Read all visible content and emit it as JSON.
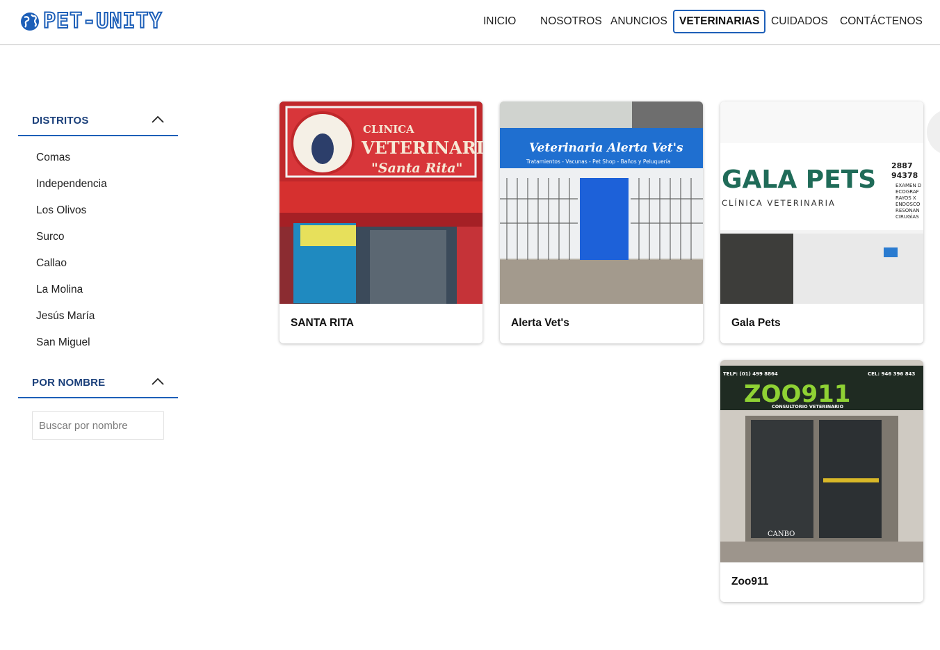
{
  "brand": {
    "name": "PET-UNITY",
    "color": "#1d5fb8"
  },
  "nav": {
    "items": [
      {
        "label": "INICIO"
      },
      {
        "label": "NOSOTROS"
      },
      {
        "label": "ANUNCIOS"
      },
      {
        "label": "VETERINARIAS",
        "active": true
      },
      {
        "label": "CUIDADOS"
      },
      {
        "label": "CONTÁCTENOS"
      }
    ]
  },
  "sidebar": {
    "districts_title": "DISTRITOS",
    "districts": [
      "Comas",
      "Independencia",
      "Los Olivos",
      "Surco",
      "Callao",
      "La Molina",
      "Jesús María",
      "San Miguel"
    ],
    "name_title": "POR NOMBRE",
    "search": {
      "placeholder": "Buscar por nombre",
      "value": ""
    }
  },
  "cards": [
    {
      "name": "SANTA RITA",
      "sign_lines": [
        "CLINICA",
        "VETERINARIA",
        "\"Santa Rita\""
      ]
    },
    {
      "name": "Alerta Vet's",
      "sign_lines": [
        "Veterinaria Alerta Vet's",
        "Tratamientos - Vacunas - Pet Shop - Baños y Peluquería"
      ]
    },
    {
      "name": "Gala Pets",
      "sign_lines": [
        "GALA PETS",
        "CLÍNICA VETERINARIA",
        "2887",
        "94378",
        "EXAMEN D",
        "ECOGRAF",
        "RAYOS X",
        "ENDOSCO",
        "RESONAN",
        "CIRUGÍAS"
      ]
    },
    {
      "name": "Zoo911",
      "sign_lines": [
        "TELF: (01) 499 8864",
        "CEL: 946 396 843",
        "ZOO911",
        "CONSULTORIO VETERINARIO",
        "CANBO"
      ]
    }
  ],
  "colors": {
    "accent": "#1d5fb8",
    "heading": "#1a3f7a"
  }
}
